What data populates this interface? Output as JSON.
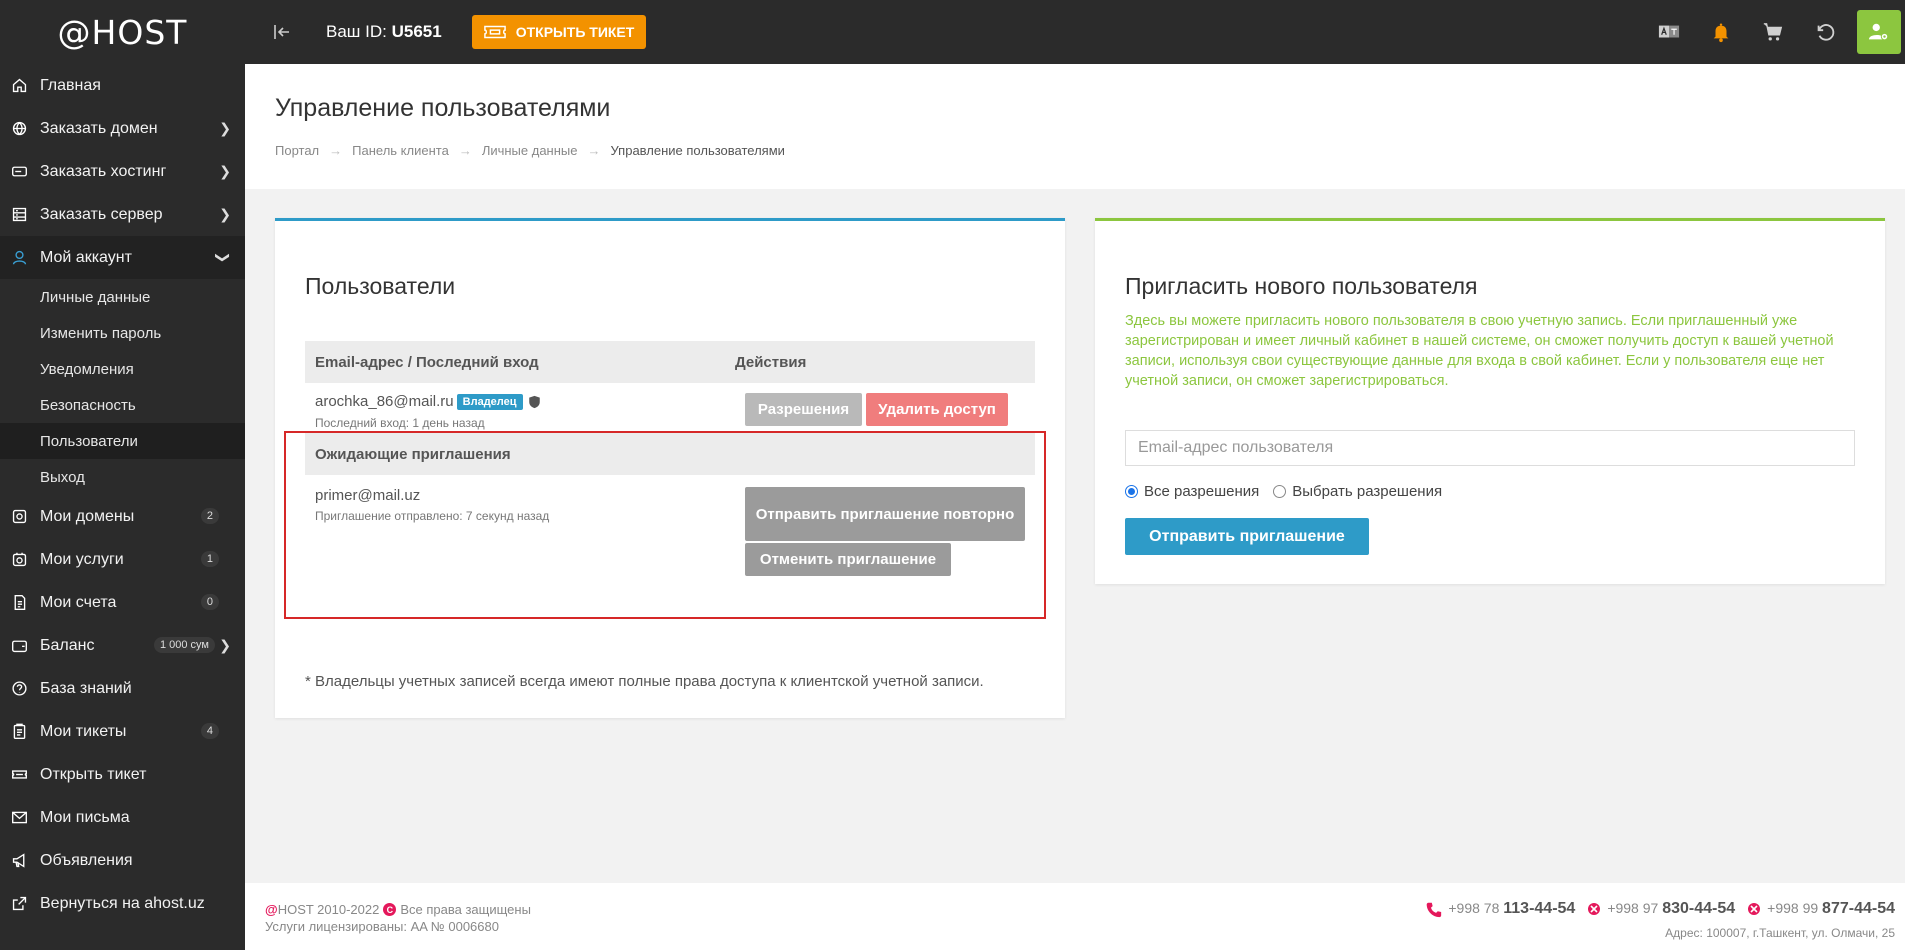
{
  "logo": "@HOST",
  "topbar": {
    "user_id_label": "Ваш ID:",
    "user_id_value": "U5651",
    "ticket_button": "ОТКРЫТЬ ТИКЕТ"
  },
  "sidebar": {
    "items": [
      {
        "label": "Главная",
        "icon": "home-icon"
      },
      {
        "label": "Заказать домен",
        "icon": "globe-icon"
      },
      {
        "label": "Заказать хостинг",
        "icon": "server-icon"
      },
      {
        "label": "Заказать сервер",
        "icon": "rack-icon"
      },
      {
        "label": "Мой аккаунт",
        "icon": "user-icon"
      }
    ],
    "account_sub": [
      "Личные данные",
      "Изменить пароль",
      "Уведомления",
      "Безопасность",
      "Пользователи",
      "Выход"
    ],
    "items2": [
      {
        "label": "Мои домены",
        "badge": "2"
      },
      {
        "label": "Мои услуги",
        "badge": "1"
      },
      {
        "label": "Мои счета",
        "badge": "0"
      },
      {
        "label": "Баланс",
        "badge": "1 000 сум"
      },
      {
        "label": "База знаний"
      },
      {
        "label": "Мои тикеты",
        "badge": "4"
      },
      {
        "label": "Открыть тикет"
      },
      {
        "label": "Мои письма"
      },
      {
        "label": "Объявления"
      },
      {
        "label": "Вернуться на ahost.uz"
      }
    ]
  },
  "page": {
    "title": "Управление пользователями",
    "breadcrumb": [
      "Портал",
      "Панель клиента",
      "Личные данные",
      "Управление пользователями"
    ]
  },
  "users": {
    "title": "Пользователи",
    "col_email": "Email-адрес / Последний вход",
    "col_actions": "Действия",
    "owner": {
      "email": "arochka_86@mail.ru",
      "badge": "Владелец",
      "last_login": "Последний вход: 1 день назад",
      "perm_button": "Разрешения",
      "delete_button": "Удалить доступ"
    },
    "pending_title": "Ожидающие приглашения",
    "pending": {
      "email": "primer@mail.uz",
      "sent": "Приглашение отправлено: 7 секунд назад",
      "resend_button": "Отправить приглашение повторно",
      "cancel_button": "Отменить приглашение"
    },
    "footnote": "* Владельцы учетных записей всегда имеют полные права доступа к клиентской учетной записи."
  },
  "invite": {
    "title": "Пригласить нового пользователя",
    "text": "Здесь вы можете пригласить нового пользователя в свою учетную запись. Если приглашенный уже зарегистрирован и имеет личный кабинет в нашей системе, он сможет получить доступ к вашей учетной записи, используя свои существующие данные для входа в свой кабинет. Если у пользователя еще нет учетной записи, он сможет зарегистрироваться.",
    "email_placeholder": "Email-адрес пользователя",
    "radio_all": "Все разрешения",
    "radio_choose": "Выбрать разрешения",
    "send_button": "Отправить приглашение"
  },
  "footer": {
    "copy_brand": "HOST 2010-2022",
    "copy_rights": "Все права защищены",
    "license": "Услуги лицензированы: AA № 0006680",
    "phones": [
      {
        "code": "+998 78",
        "num": "113-44-54"
      },
      {
        "code": "+998 97",
        "num": "830-44-54"
      },
      {
        "code": "+998 99",
        "num": "877-44-54"
      }
    ],
    "address": "Адрес: 100007, г.Ташкент, ул. Олмачи, 25"
  },
  "colors": {
    "accent_blue": "#2e9bc8",
    "accent_green": "#8cc63f",
    "ticket_orange": "#f39200",
    "danger": "#f07d7d",
    "highlight_red": "#d62828"
  }
}
